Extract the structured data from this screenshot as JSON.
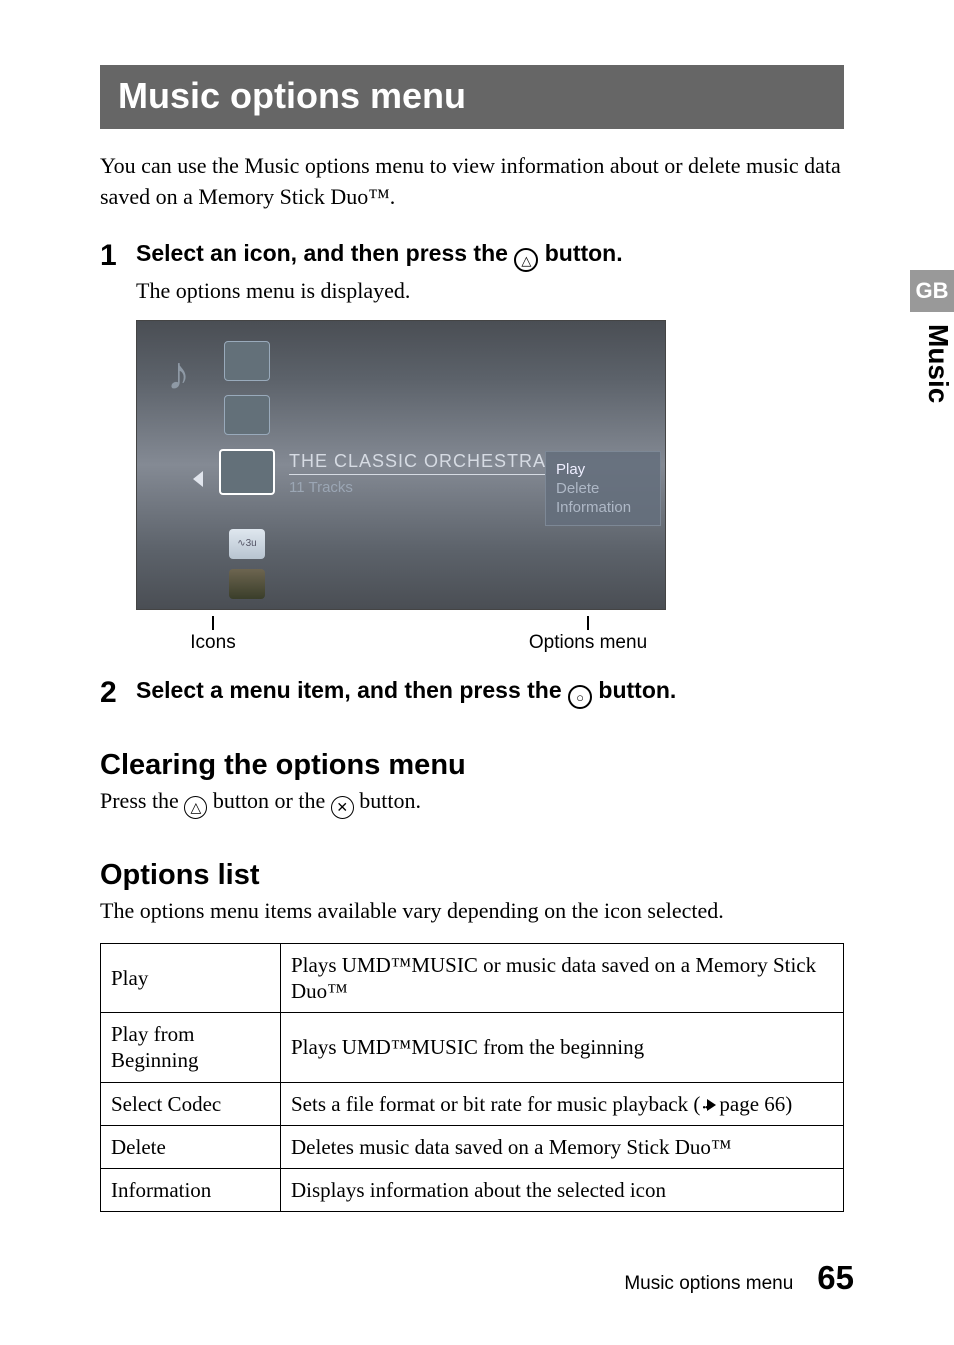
{
  "title": "Music options menu",
  "intro": "You can use the Music options menu to view information about or delete music data saved on a Memory Stick Duo™.",
  "steps": [
    {
      "num": "1",
      "title_before": "Select an icon, and then press the ",
      "button_glyph": "△",
      "title_after": " button.",
      "desc": "The options menu is displayed."
    },
    {
      "num": "2",
      "title_before": "Select a menu item, and then press the ",
      "button_glyph": "○",
      "title_after": " button.",
      "desc": ""
    }
  ],
  "screenshot": {
    "album_title": "THE CLASSIC ORCHESTRA",
    "album_sub": "11 Tracks",
    "menu": [
      "Play",
      "Delete",
      "Information"
    ],
    "icon3u": "∿3u"
  },
  "callouts": {
    "left": "Icons",
    "right": "Options menu"
  },
  "clearing": {
    "heading": "Clearing the options menu",
    "text_before": "Press the ",
    "glyph1": "△",
    "text_mid": " button or the ",
    "glyph2": "✕",
    "text_after": " button."
  },
  "options_list": {
    "heading": "Options list",
    "text": "The options menu items available vary depending on the icon selected."
  },
  "table": [
    {
      "name": "Play",
      "desc": "Plays UMD™MUSIC or music data saved on a Memory Stick Duo™"
    },
    {
      "name": "Play from Beginning",
      "desc": "Plays UMD™MUSIC from the beginning"
    },
    {
      "name": "Select Codec",
      "desc_before": "Sets a file format or bit rate for music playback (",
      "desc_after": "page 66)"
    },
    {
      "name": "Delete",
      "desc": "Deletes music data saved on a Memory Stick Duo™"
    },
    {
      "name": "Information",
      "desc": "Displays information about the selected icon"
    }
  ],
  "side": {
    "gb": "GB",
    "section": "Music"
  },
  "footer": {
    "label": "Music options menu",
    "page": "65"
  }
}
